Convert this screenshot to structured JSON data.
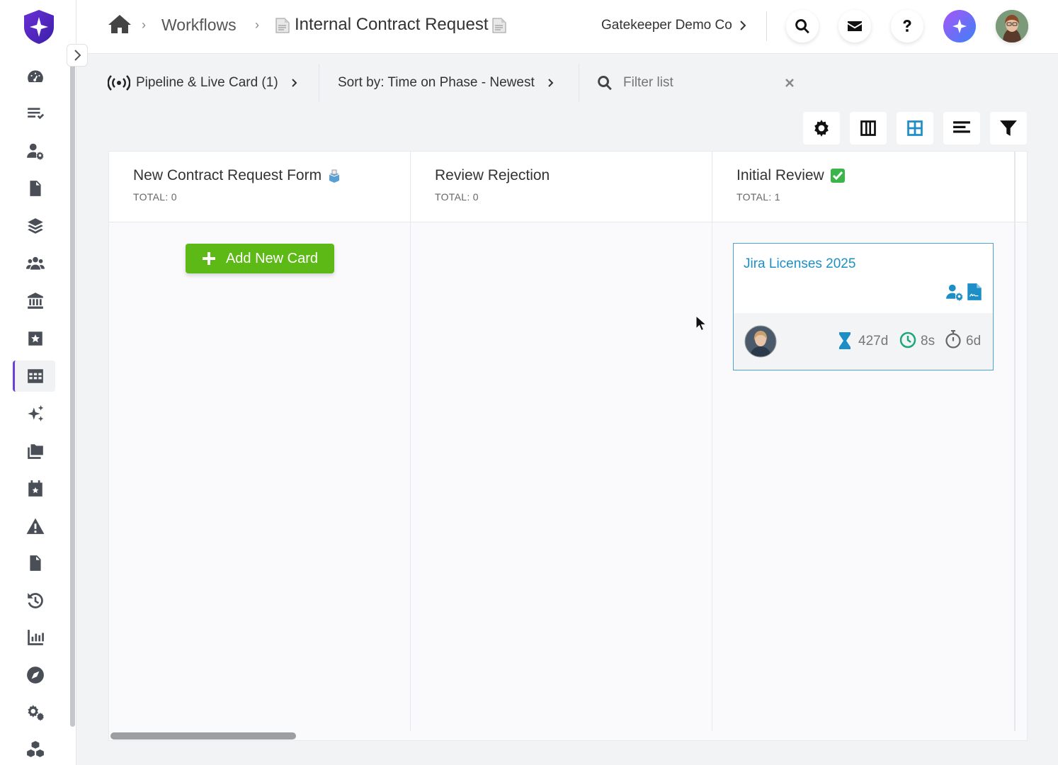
{
  "breadcrumb": {
    "workflows": "Workflows",
    "current": "Internal Contract Request"
  },
  "company": "Gatekeeper Demo Co",
  "toolbar": {
    "pipeline": "Pipeline & Live Card (1)",
    "sort": "Sort by: Time on Phase - Newest",
    "filter_placeholder": "Filter list"
  },
  "columns": [
    {
      "title": "New Contract Request Form",
      "total": "TOTAL: 0"
    },
    {
      "title": "Review Rejection",
      "total": "TOTAL: 0"
    },
    {
      "title": "Initial Review",
      "total": "TOTAL: 1"
    }
  ],
  "add_card_label": "Add New Card",
  "card": {
    "title": "Jira Licenses 2025",
    "stat_total": "427d",
    "stat_phase": "8s",
    "stat_timer": "6d"
  },
  "colors": {
    "accent_purple": "#6c3fd8",
    "green": "#5cb916",
    "blue": "#1e8fc6",
    "teal": "#1aa87a"
  }
}
